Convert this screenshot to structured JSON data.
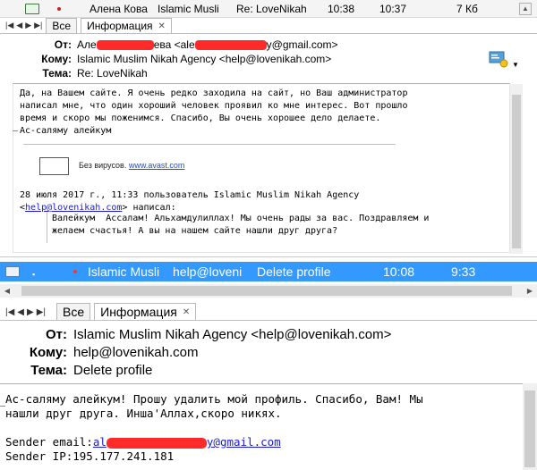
{
  "panel1": {
    "list_row": {
      "sender": "Алена Кова",
      "recipient": "Islamic Musli",
      "subject": "Re: LoveNikah",
      "time_sent": "10:38",
      "time_received": "10:37",
      "size": "7 Кб"
    },
    "tabs": [
      "Все",
      "Информация"
    ],
    "headers": {
      "from_label": "От:",
      "from_prefix": "Але",
      "from_middle": "ева <ale",
      "from_suffix": "y@gmail.com>",
      "to_label": "Кому:",
      "to_value": "Islamic Muslim Nikah Agency <help@lovenikah.com>",
      "subject_label": "Тема:",
      "subject_value": "Re: LoveNikah"
    },
    "body_lines": [
      "Да, на Вашем сайте. Я очень редко заходила на сайт, но Ваш администратор",
      "написал мне, что один хороший человек проявил ко мне интерес. Вот прошло",
      "время и скоро мы поженимся. Спасибо, Вы очень хорошее дело делаете.",
      "Ас-саляму алейкум"
    ],
    "avast_prefix": "Без вирусов. ",
    "avast_link": "www.avast.com",
    "quote_header_line1": "28 июля 2017 г., 11:33 пользователь Islamic Muslim Nikah Agency",
    "quote_header_link": "help@lovenikah.com",
    "quote_header_link_open": "<",
    "quote_header_after": "> написал:",
    "quote_lines": [
      "Валейкум  Ассалам! Альхамдулиллах! Мы очень рады за вас. Поздравляем и",
      "желаем счастья! А вы на нашем сайте нашли друг друга?"
    ]
  },
  "panel2": {
    "list_row": {
      "sender": "Islamic Musli",
      "from_address": "help@loveni",
      "subject": "Delete profile",
      "time_sent": "10:08",
      "time_received": "9:33"
    },
    "tabs": [
      "Все",
      "Информация"
    ],
    "headers": {
      "from_label": "От:",
      "from_value": "Islamic Muslim Nikah Agency <help@lovenikah.com>",
      "to_label": "Кому:",
      "to_value": "help@lovenikah.com",
      "subject_label": "Тема:",
      "subject_value": "Delete profile"
    },
    "body_lines": [
      "Ас-саляму алейкум! Прошу удалить мой профиль. Спасибо, Вам! Мы",
      "нашли друг друга. Инша'Аллах,скоро никях."
    ],
    "sender_email_label": "Sender email:",
    "sender_email_start": "al",
    "sender_email_end": "y@gmail.com",
    "sender_ip_line": "Sender IP:195.177.241.181"
  },
  "icons": {
    "message_icon": "envelope-icon",
    "flag_icon": "red-dot-icon",
    "contact_card_icon": "contact-card-icon"
  },
  "colors": {
    "selection": "#3399ff",
    "redaction": "#ff2a2a",
    "separator": "#f6a030",
    "link": "#1a1adb"
  }
}
